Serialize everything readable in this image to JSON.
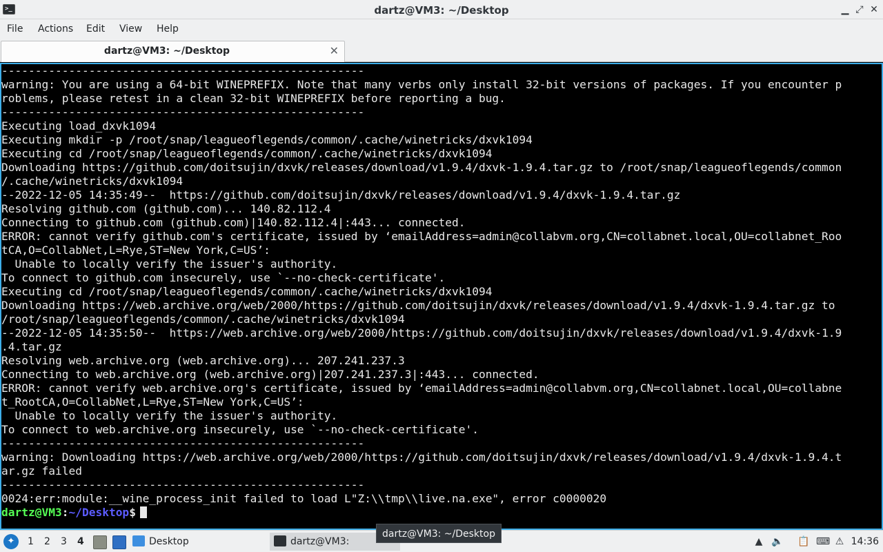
{
  "window": {
    "title": "dartz@VM3: ~/Desktop",
    "app_icon_glyph": ">_",
    "minimize_glyph": "▁",
    "maximize_glyph": "⤢",
    "close_glyph": "✕"
  },
  "menu": [
    "File",
    "Actions",
    "Edit",
    "View",
    "Help"
  ],
  "tab": {
    "label": "dartz@VM3: ~/Desktop",
    "close_glyph": "✕"
  },
  "terminal": {
    "lines": [
      "------------------------------------------------------",
      "warning: You are using a 64-bit WINEPREFIX. Note that many verbs only install 32-bit versions of packages. If you encounter p",
      "roblems, please retest in a clean 32-bit WINEPREFIX before reporting a bug.",
      "------------------------------------------------------",
      "Executing load_dxvk1094",
      "Executing mkdir -p /root/snap/leagueoflegends/common/.cache/winetricks/dxvk1094",
      "Executing cd /root/snap/leagueoflegends/common/.cache/winetricks/dxvk1094",
      "Downloading https://github.com/doitsujin/dxvk/releases/download/v1.9.4/dxvk-1.9.4.tar.gz to /root/snap/leagueoflegends/common",
      "/.cache/winetricks/dxvk1094",
      "--2022-12-05 14:35:49--  https://github.com/doitsujin/dxvk/releases/download/v1.9.4/dxvk-1.9.4.tar.gz",
      "Resolving github.com (github.com)... 140.82.112.4",
      "Connecting to github.com (github.com)|140.82.112.4|:443... connected.",
      "ERROR: cannot verify github.com's certificate, issued by ‘emailAddress=admin@collabvm.org,CN=collabnet.local,OU=collabnet_Roo",
      "tCA,O=CollabNet,L=Rye,ST=New York,C=US’:",
      "  Unable to locally verify the issuer's authority.",
      "To connect to github.com insecurely, use `--no-check-certificate'.",
      "Executing cd /root/snap/leagueoflegends/common/.cache/winetricks/dxvk1094",
      "Downloading https://web.archive.org/web/2000/https://github.com/doitsujin/dxvk/releases/download/v1.9.4/dxvk-1.9.4.tar.gz to",
      "/root/snap/leagueoflegends/common/.cache/winetricks/dxvk1094",
      "--2022-12-05 14:35:50--  https://web.archive.org/web/2000/https://github.com/doitsujin/dxvk/releases/download/v1.9.4/dxvk-1.9",
      ".4.tar.gz",
      "Resolving web.archive.org (web.archive.org)... 207.241.237.3",
      "Connecting to web.archive.org (web.archive.org)|207.241.237.3|:443... connected.",
      "ERROR: cannot verify web.archive.org's certificate, issued by ‘emailAddress=admin@collabvm.org,CN=collabnet.local,OU=collabne",
      "t_RootCA,O=CollabNet,L=Rye,ST=New York,C=US’:",
      "  Unable to locally verify the issuer's authority.",
      "To connect to web.archive.org insecurely, use `--no-check-certificate'.",
      "------------------------------------------------------",
      "warning: Downloading https://web.archive.org/web/2000/https://github.com/doitsujin/dxvk/releases/download/v1.9.4/dxvk-1.9.4.t",
      "ar.gz failed",
      "------------------------------------------------------",
      "0024:err:module:__wine_process_init failed to load L\"Z:\\\\tmp\\\\live.na.exe\", error c0000020"
    ],
    "prompt": {
      "user_host": "dartz@VM3",
      "colon": ":",
      "path": "~/Desktop",
      "symbol": "$"
    }
  },
  "colors": {
    "prompt_user": "#55ff55",
    "prompt_path": "#5c5cff",
    "terminal_bg": "#000000",
    "terminal_fg": "#e8e8e8",
    "focus_border": "#3daee9"
  },
  "taskbar": {
    "start_icon": "lxqt-start-icon",
    "workspaces": [
      "1",
      "2",
      "3",
      "4"
    ],
    "active_workspace": "4",
    "tasks": [
      {
        "label": "Desktop",
        "icon": "folder-icon"
      },
      {
        "label": "dartz@VM3: ~/Desktop",
        "icon": "terminal-icon"
      }
    ],
    "tooltip": "dartz@VM3: ~/Desktop",
    "clock": "14:36"
  }
}
